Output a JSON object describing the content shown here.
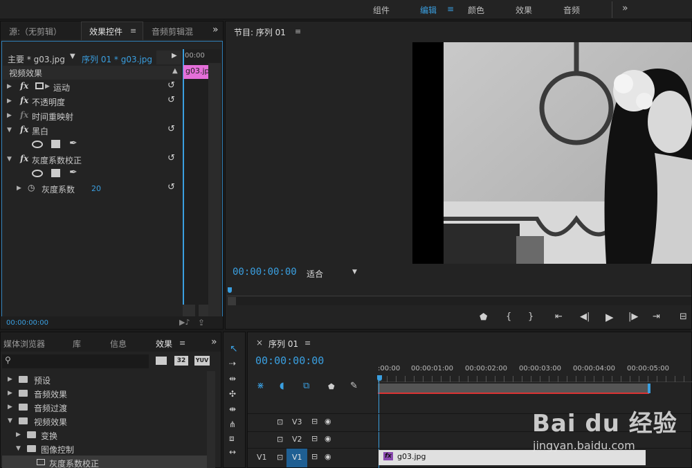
{
  "workspaces": {
    "items": [
      "组件",
      "编辑",
      "颜色",
      "效果",
      "音频"
    ],
    "active_menu": "≡",
    "more": "»"
  },
  "effect_controls": {
    "tabs": [
      "源:（无剪辑）",
      "效果控件",
      "音频剪辑混"
    ],
    "tab_menu": "≡",
    "more": "»",
    "master_label": "主要 * g03.jpg",
    "sequence_label": "序列 01 * g03.jpg",
    "timecode_head": "00:00",
    "clip_name": "g03.jp",
    "section_title": "视频效果",
    "effects": [
      {
        "name": "运动",
        "fx": "fx",
        "reset": "↺"
      },
      {
        "name": "不透明度",
        "fx": "fx",
        "reset": "↺"
      },
      {
        "name": "时间重映射",
        "fx": "fx"
      },
      {
        "name": "黑白",
        "fx": "fx",
        "reset": "↺"
      },
      {
        "name": "灰度系数校正",
        "fx": "fx",
        "reset": "↺"
      }
    ],
    "param": {
      "name": "灰度系数",
      "value": "20",
      "reset": "↺"
    },
    "footer_timecode": "00:00:00:00"
  },
  "program": {
    "title": "节目: 序列 01",
    "menu": "≡",
    "timecode": "00:00:00:00",
    "fit": "适合"
  },
  "project": {
    "tabs": [
      "媒体浏览器",
      "库",
      "信息",
      "效果"
    ],
    "menu": "≡",
    "more": "»",
    "search_placeholder": "",
    "badges": [
      "32",
      "YUV"
    ],
    "tree": [
      {
        "label": "预设",
        "level": 0,
        "open": false
      },
      {
        "label": "音频效果",
        "level": 0,
        "open": false
      },
      {
        "label": "音频过渡",
        "level": 0,
        "open": false
      },
      {
        "label": "视频效果",
        "level": 0,
        "open": true
      },
      {
        "label": "变换",
        "level": 1,
        "open": false
      },
      {
        "label": "图像控制",
        "level": 1,
        "open": true
      },
      {
        "label": "灰度系数校正",
        "level": 2,
        "open": false
      }
    ]
  },
  "timeline": {
    "close": "×",
    "title": "序列 01",
    "menu": "≡",
    "timecode": "00:00:00:00",
    "ruler": [
      ":00:00",
      "00:00:01:00",
      "00:00:02:00",
      "00:00:03:00",
      "00:00:04:00",
      "00:00:05:00"
    ],
    "tracks": [
      {
        "name": "V3",
        "src": ""
      },
      {
        "name": "V2",
        "src": ""
      },
      {
        "name": "V1",
        "src": "V1"
      }
    ],
    "clip": {
      "fx": "fx",
      "name": "g03.jpg"
    }
  },
  "watermark": {
    "brand": "Bai du 经验",
    "url": "jingyan.baidu.com"
  }
}
